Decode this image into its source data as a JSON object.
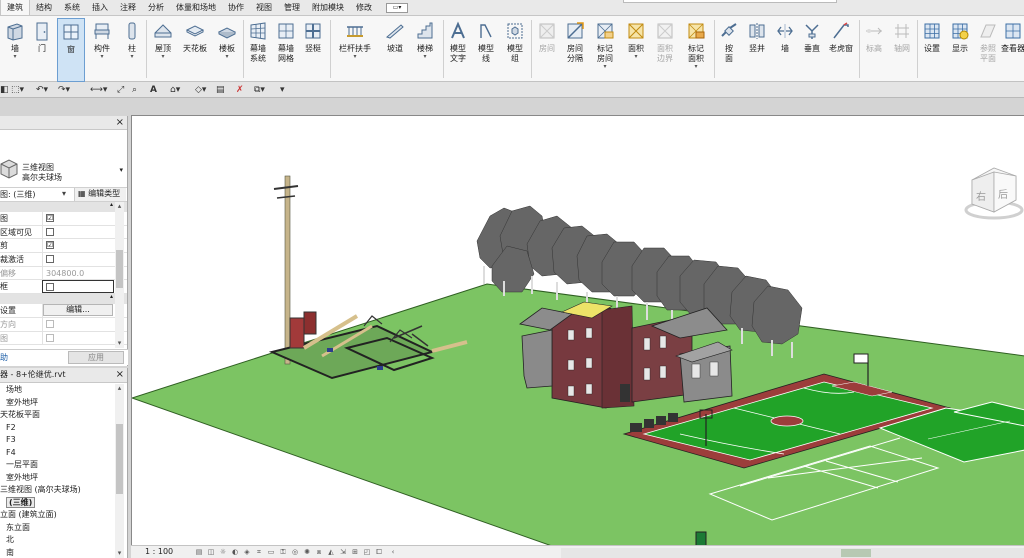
{
  "ribbon_tabs": [
    "建筑",
    "结构",
    "系统",
    "插入",
    "注释",
    "分析",
    "体量和场地",
    "协作",
    "视图",
    "管理",
    "附加模块",
    "修改"
  ],
  "ribbon_tab_menu_glyph": "▭▾",
  "ribbon": {
    "wall": "墙",
    "door": "门",
    "window": "窗",
    "component": "构件",
    "column": "柱",
    "roof": "屋顶",
    "ceiling": "天花板",
    "floor": "楼板",
    "curtain_system_l1": "幕墙",
    "curtain_system_l2": "系统",
    "curtain_grid_l1": "幕墙",
    "curtain_grid_l2": "网格",
    "mullion": "竖梃",
    "railing": "栏杆扶手",
    "ramp": "坡道",
    "stair": "楼梯",
    "model_text_l1": "模型",
    "model_text_l2": "文字",
    "model_line_l1": "模型",
    "model_line_l2": "线",
    "model_group_l1": "模型",
    "model_group_l2": "组",
    "room": "房间",
    "room_sep_l1": "房间",
    "room_sep_l2": "分隔",
    "tag_room_l1": "标记",
    "tag_room_l2": "房间",
    "area": "面积",
    "area_boundary_l1": "面积",
    "area_boundary_l2": "边界",
    "tag_area_l1": "标记",
    "tag_area_l2": "面积",
    "by_face_l1": "按",
    "by_face_l2": "面",
    "shaft": "竖井",
    "wall_opening": "墙",
    "vertical": "垂直",
    "dormer": "老虎窗",
    "level": "标高",
    "grid": "轴网",
    "set": "设置",
    "show": "显示",
    "ref_plane_l1": "参照",
    "ref_plane_l2": "平面",
    "viewer": "查看器",
    "panel_dropdown": "▾"
  },
  "properties": {
    "close": "×",
    "type_line1": "三维视图",
    "type_line2": "高尔夫球场",
    "type_arrow": "▾",
    "view_selector": "图: (三维)",
    "view_selector_arrow": "▾",
    "edit_type": "编辑类型",
    "group_arrow": "▴",
    "rows": [
      {
        "label": "图",
        "value": "☑"
      },
      {
        "label": "区域可见",
        "value": ""
      },
      {
        "label": "剪",
        "value": "☑"
      },
      {
        "label": "裁激活",
        "value": ""
      },
      {
        "label": "偏移",
        "value": "304800.0"
      },
      {
        "label": "框",
        "value": ""
      }
    ],
    "group2_label": "设置",
    "group2_value": "编辑...",
    "row_dir": "方向",
    "row_last": "图",
    "help": "助",
    "apply": "应用",
    "scroll_up": "▴",
    "scroll_down": "▾"
  },
  "browser": {
    "title": "器 - 8+伦继优.rvt",
    "close": "×",
    "items": [
      "场地",
      "室外地坪",
      "天花板平面",
      "F2",
      "F3",
      "F4",
      "一层平面",
      "室外地坪",
      "三维视图 (高尔夫球场)",
      "(三维)",
      "立面 (建筑立面)",
      "东立面",
      "北",
      "南"
    ],
    "scroll_up": "▴",
    "scroll_down": "▾"
  },
  "viewcube": {
    "right": "右",
    "back": "后"
  },
  "status": {
    "scale": "1 : 100"
  },
  "colors": {
    "grass": "#7cc463",
    "court_green": "#21a328",
    "court_red": "#9c3d3b",
    "building_brick": "#7a3f43",
    "roof_grey": "#8c8c8c"
  }
}
